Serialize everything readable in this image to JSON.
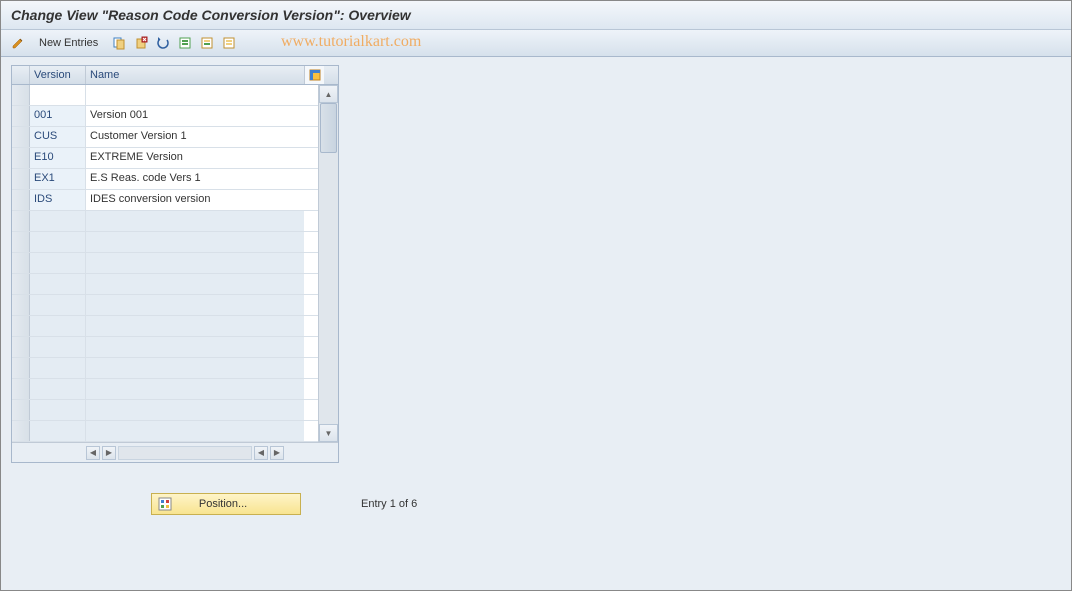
{
  "title": "Change View \"Reason Code Conversion Version\": Overview",
  "toolbar": {
    "new_entries": "New Entries"
  },
  "watermark": "www.tutorialkart.com",
  "grid": {
    "headers": {
      "version": "Version",
      "name": "Name"
    },
    "rows": [
      {
        "version": "",
        "name": ""
      },
      {
        "version": "001",
        "name": "Version 001"
      },
      {
        "version": "CUS",
        "name": "Customer Version 1"
      },
      {
        "version": "E10",
        "name": "EXTREME Version"
      },
      {
        "version": "EX1",
        "name": "E.S Reas. code Vers 1"
      },
      {
        "version": "IDS",
        "name": "IDES conversion version"
      }
    ],
    "empty_row_count": 11
  },
  "position_button": "Position...",
  "entry_status": "Entry 1 of 6"
}
